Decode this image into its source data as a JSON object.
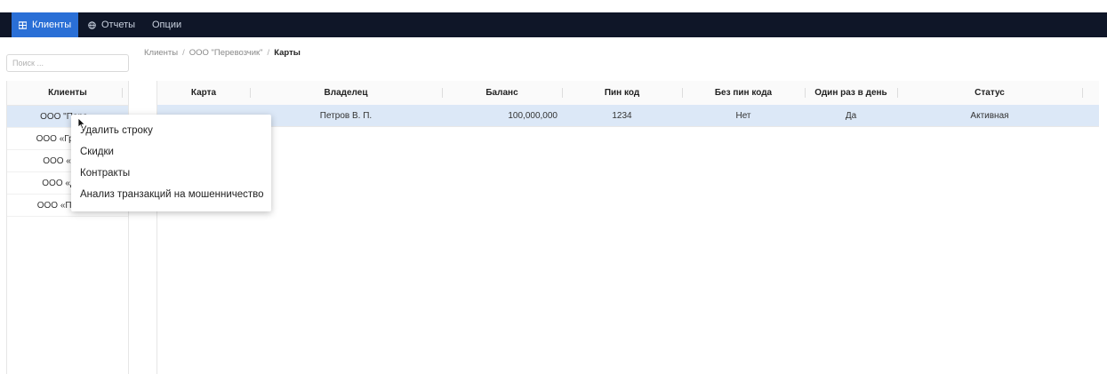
{
  "topnav": {
    "clients_label": "Клиенты",
    "reports_label": "Отчеты",
    "options_label": "Опции",
    "clients_icon": "grid-icon",
    "reports_icon": "globe-icon"
  },
  "search": {
    "placeholder": "Поиск ..."
  },
  "breadcrumb": {
    "items": [
      "Клиенты",
      "ООО \"Перевозчик\"",
      "Карты"
    ],
    "separator": "/"
  },
  "clients": {
    "header": "Клиенты",
    "items": [
      "ООО \"Пере...",
      "ООО «Грузоп...",
      "ООО «Так...",
      "ООО «Дос...",
      "ООО «Птице..."
    ]
  },
  "cards_table": {
    "columns": [
      "Карта",
      "Владелец",
      "Баланс",
      "Пин код",
      "Без пин кода",
      "Один раз в день",
      "Статус"
    ],
    "rows": [
      {
        "card": "",
        "owner": "Петров В. П.",
        "balance": "100,000,000",
        "pin": "1234",
        "no_pin": "Нет",
        "once_a_day": "Да",
        "status": "Активная"
      }
    ]
  },
  "context_menu": {
    "items": [
      "Удалить строку",
      "Скидки",
      "Контракты",
      "Анализ транзакций на мошенничество"
    ]
  },
  "colors": {
    "topbar_bg": "#0f1628",
    "accent": "#2a6fd6",
    "row_selected": "#dce8f7"
  }
}
